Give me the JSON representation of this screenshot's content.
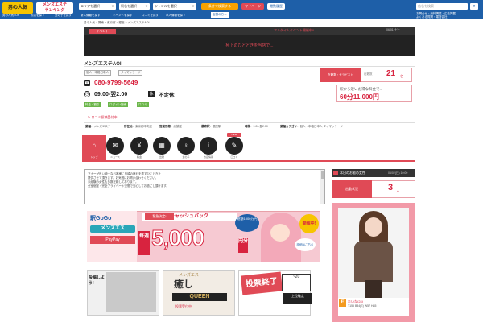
{
  "header": {
    "logo": "男の人気",
    "ranking_line1": "メンズエステ",
    "ranking_line2": "ランキング",
    "area_select": "エリアを選択",
    "station_select": "駅名を選択",
    "genre_select": "ジャンルを選択",
    "condition_btn": "条件で検索する",
    "favorites_btn": "マイページ",
    "history_btn": "閲覧履歴",
    "search_placeholder": "店名を検索",
    "nav": [
      "男の人気TOP",
      "お店を探す",
      "女の子を探す",
      "新人情報を探す",
      "イベントを探す",
      "口コミを探す",
      "求人情報を探す"
    ],
    "nav_right": "店舗の方へ",
    "right_links_1": "お問合せ・無料掲載・広告掲載",
    "right_links_2": "よくある質問・運営会社"
  },
  "breadcrumb": "男の人気 > 関東 > 東京都 > 銀座 > メンズエステAOI",
  "event": {
    "label": "イベント",
    "headline": "フルタイムイベント開催中!!",
    "date": "06/01(土)~",
    "message": "極上のひとときを当店で..."
  },
  "shop": {
    "name": "メンズエステAOI",
    "tags": [
      "個人・本格日本人",
      "タイマッサージ"
    ],
    "phone": "080-9799-5649",
    "hours": "09:00-翌2:00",
    "holiday_icon_char": "休",
    "holiday": "不定休",
    "green_tags": [
      "料金・割引",
      "ログイン施術",
      "口コミ"
    ],
    "review_link": "口コミ投稿受付中"
  },
  "counts": {
    "label": "在籍数・セラピスト",
    "sub": "在籍数",
    "value": "21",
    "unit": "名"
  },
  "price": {
    "title": "駅から近いお得な料金で...",
    "range": "60分11,000円"
  },
  "info_row": {
    "genre_k": "業種",
    "genre_v": "メンズエステ",
    "area_k": "所在地",
    "area_v": "東京都中央区",
    "station_k": "最寄駅",
    "station_v": "銀座駅",
    "format_k": "営業形態",
    "format_v": "店舗型",
    "time_k": "時間",
    "time_v": "9:00-翌2:00",
    "cat_k": "業種カテゴリ",
    "cat_v": "個人・本格日本人 タイマッサージ"
  },
  "icons": [
    {
      "label": "トップ",
      "glyph": "⌂"
    },
    {
      "label": "ニュース",
      "glyph": "✉"
    },
    {
      "label": "料金",
      "glyph": "¥"
    },
    {
      "label": "出勤",
      "glyph": "▦"
    },
    {
      "label": "女の子",
      "glyph": "♀"
    },
    {
      "label": "お店情報",
      "glyph": "i"
    },
    {
      "label": "口コミ",
      "glyph": "✎"
    }
  ],
  "new_badge": "NEW",
  "message_lines": [
    "マナーが良い紳士なお客様に日頃の疲れを癒すひとときを",
    "提供させて頂きます。お気軽にお問い合わせください。",
    "未経験の女性も多数在籍しております。",
    "全室個室・完全プライベート空間で安心してお過ごし頂けます。"
  ],
  "cashback": {
    "gogo": "駅GoGo",
    "mens": "メンズエス",
    "pay": "PayPay",
    "urgent": "緊急決定!",
    "head": "キャッシュバック",
    "every": "毎週",
    "amount": "5,000",
    "yen": "円分",
    "total": "総額1000万円",
    "kaisai": "開催中!",
    "check": "詳細はこちら"
  },
  "banners": {
    "b1_text": "投稿しよう!",
    "b2_title": "メンズエス",
    "b2_iyashi": "癒し",
    "b2_queen": "QUEEN",
    "b2_vote": "投票受付中",
    "b3_stamp": "投票終了",
    "b3_date": "~20",
    "b3_fix": "上位確定"
  },
  "today": {
    "title": "本日のお勧め女性",
    "date": "06/02(日) 10:00",
    "count_label": "出勤状況",
    "count_value": "3",
    "count_unit": "人",
    "badge": "E",
    "name": "れいな(24)",
    "size": "T155 B84(E) W57 H85"
  },
  "colors": {
    "brand_blue": "#1e5fa8",
    "accent_red": "#e04a56",
    "logo_yellow": "#f7c400"
  }
}
